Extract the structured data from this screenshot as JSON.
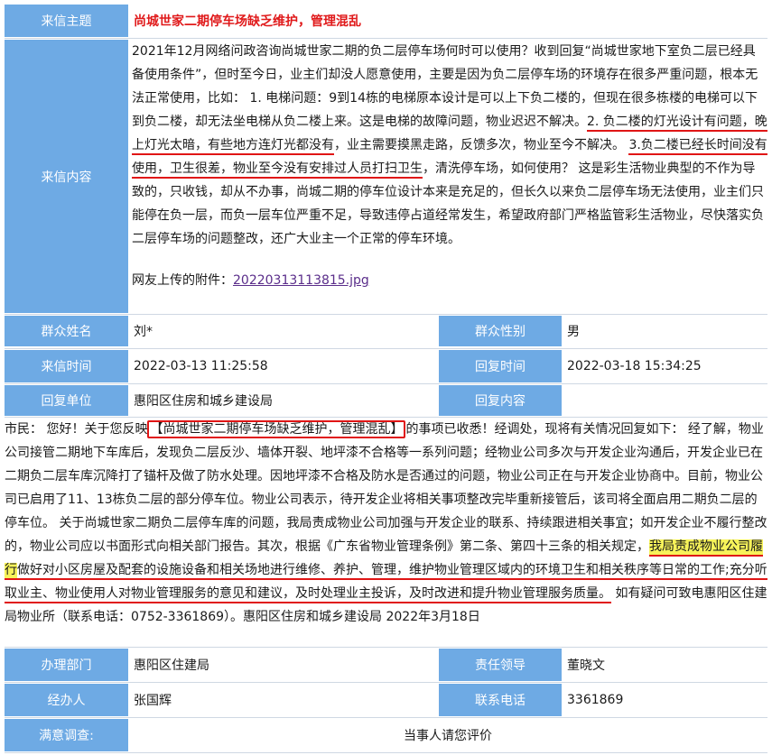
{
  "letter": {
    "subject_label": "来信主题",
    "subject": "尚城世家二期停车场缺乏维护，管理混乱",
    "content_label": "来信内容",
    "content_part1": "2021年12月网络问政咨询尚城世家二期的负二层停车场何时可以使用？收到回复“尚城世家地下室负二层已经具备使用条件”，但时至今日，业主们却没人愿意使用，主要是因为负二层停车场的环境存在很多严重问题，根本无法正常使用，比如： 1. 电梯问题：9到14栋的电梯原本设计是可以上下负二楼的，但现在很多栋楼的电梯可以下到负二楼，却无法坐电梯从负二楼上来。这是电梯的故障问题，物业迟迟不解决。",
    "content_u1": "2. 负二楼的灯光设计有问题，晚上灯光太暗，有些地方连灯光都没有",
    "content_part2": "，业主需要摸黑走路，反馈多次，物业至今不解决。 ",
    "content_u2": "3.负二楼已经长时间没有使用，卫生很差，物业至今没有安排过人员打扫卫生",
    "content_part3": "，清洗停车场，如何使用？ 这是彩生活物业典型的不作为导致的，只收钱，却从不办事，尚城二期的停车位设计本来是充足的，但长久以来负二层停车场无法使用，业主们只能停在负一层，而负一层车位严重不足，导致违停占道经常发生，希望政府部门严格监管彩生活物业，尽快落实负二层停车场的问题整改，还广大业主一个正常的停车环境。",
    "attachment_label": "网友上传的附件：",
    "attachment_file": "20220313113815.jpg",
    "name_label": "群众姓名",
    "name": "刘*",
    "gender_label": "群众性别",
    "gender": "男",
    "time_label": "来信时间",
    "time": "2022-03-13 11:25:58",
    "reply_time_label": "回复时间",
    "reply_time": "2022-03-18 15:34:25",
    "unit_label": "回复单位",
    "unit": "惠阳区住房和城乡建设局",
    "reply_content_label": "回复内容"
  },
  "reply": {
    "part1": "市民： 您好！关于您反映",
    "boxed": "【尚城世家二期停车场缺乏维护，管理混乱】",
    "part2": "的事项已收悉！经调处，现将有关情况回复如下： 经了解，物业公司接管二期地下车库后，发现负二层反沙、墙体开裂、地坪漆不合格等一系列问题；经物业公司多次与开发企业沟通后，开发企业已在二期负二层车库沉降打了锚杆及做了防水处理。因地坪漆不合格及防水是否通过的问题，物业公司正在与开发企业协商中。目前，物业公司已启用了11、13栋负二层的部分停车位。物业公司表示，待开发企业将相关事项整改完毕重新接管后，该司将全面启用二期负二层的停车位。 关于尚城世家二期负二层停车库的问题，我局责成物业公司加强与开发企业的联系、持续跟进相关事宜；如开发企业不履行整改的，物业公司应以书面形式向相关部门报告。其次，根据《广东省物业管理条例》第二条、第四十三条的相关规定，",
    "highlight": "我局责成物业公司履行",
    "underlined": "做好对小区房屋及配套的设施设备和相关场地进行维修、养护、管理，维护物业管理区域内的环境卫生和相关秩序等日常的工作;充分听取业主、物业使用人对物业管理服务的意见和建议，及时处理业主投诉，及时改进和提升物业管理服务质量。",
    "part3": " 如有疑问可致电惠阳区住建局物业所（联系电话：0752-3361869）。惠阳区住房和城乡建设局 2022年3月18日"
  },
  "handling": {
    "dept_label": "办理部门",
    "dept": "惠阳区住建局",
    "leader_label": "责任领导",
    "leader": "董晓文",
    "handler_label": "经办人",
    "handler": "张国辉",
    "phone_label": "联系电话",
    "phone": "3361869",
    "survey_label": "满意调查:",
    "survey_value": "当事人请您评价"
  },
  "colors": {
    "label_bg": "#6eaae4",
    "title_red": "#e0191a",
    "annotation_red": "#e01515",
    "highlight_yellow": "#f7f35a"
  }
}
